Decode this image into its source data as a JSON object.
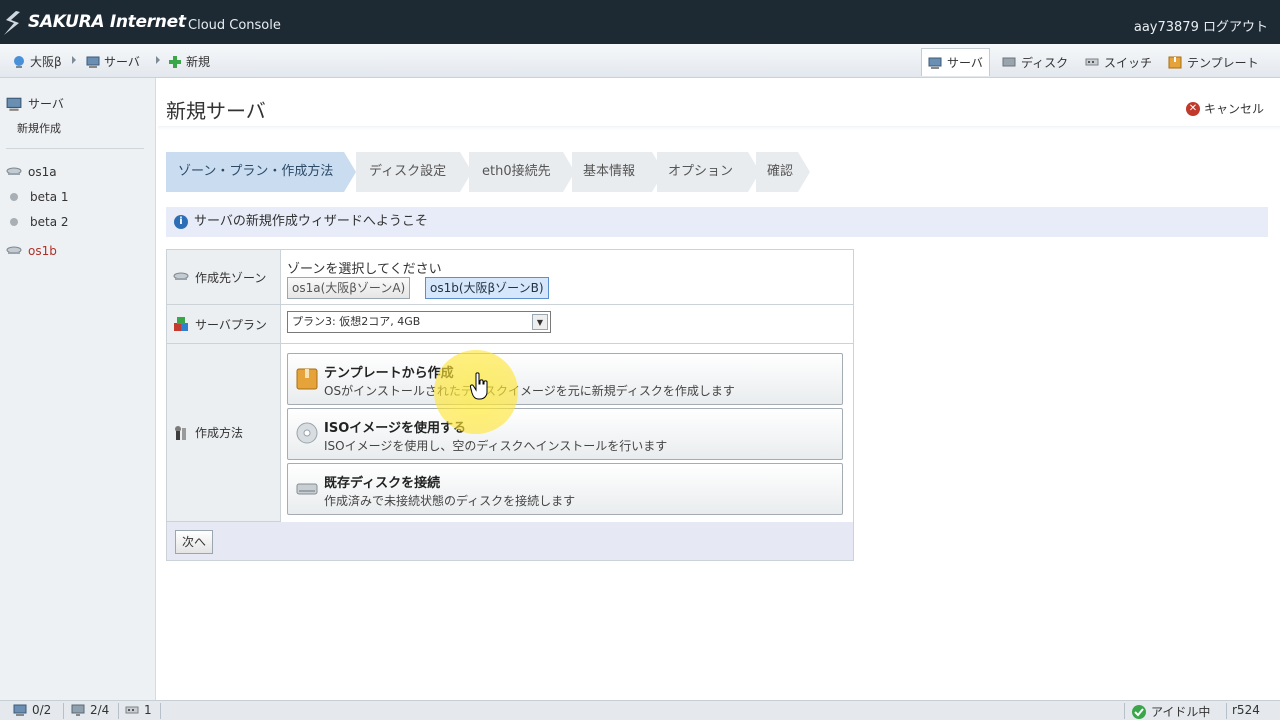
{
  "header": {
    "brand": "SAKURA Internet",
    "brand_sub": "Cloud Console",
    "user_id": "aay73879",
    "logout": "ログアウト"
  },
  "breadcrumb": {
    "zone": "大阪β",
    "server": "サーバ",
    "new": "新規"
  },
  "topnav": {
    "server": "サーバ",
    "disk": "ディスク",
    "switch": "スイッチ",
    "template": "テンプレート",
    "active": "server"
  },
  "sidebar": {
    "section": "サーバ",
    "section_sub": "新規作成",
    "items": [
      {
        "label": "os1a"
      },
      {
        "label": "beta 1"
      },
      {
        "label": "beta 2"
      },
      {
        "label": "os1b"
      }
    ]
  },
  "page": {
    "title": "新規サーバ",
    "cancel": "キャンセル"
  },
  "wizard": {
    "steps": [
      {
        "label": "ゾーン・プラン・作成方法",
        "active": true
      },
      {
        "label": "ディスク設定",
        "active": false
      },
      {
        "label": "eth0接続先",
        "active": false
      },
      {
        "label": "基本情報",
        "active": false
      },
      {
        "label": "オプション",
        "active": false
      },
      {
        "label": "確認",
        "active": false
      }
    ]
  },
  "info": {
    "text": "サーバの新規作成ウィザードへようこそ"
  },
  "form": {
    "zone_label": "作成先ゾーン",
    "zone_prompt": "ゾーンを選択してください",
    "zones": [
      {
        "label": "os1a(大阪βゾーンA)",
        "selected": false
      },
      {
        "label": "os1b(大阪βゾーンB)",
        "selected": true
      }
    ],
    "plan_label": "サーバプラン",
    "plan_value": "プラン3: 仮想2コア, 4GB",
    "method_label": "作成方法",
    "methods": [
      {
        "title": "テンプレートから作成",
        "desc": "OSがインストールされたディスクイメージを元に新規ディスクを作成します",
        "icon": "box-icon"
      },
      {
        "title": "ISOイメージを使用する",
        "desc": "ISOイメージを使用し、空のディスクへインストールを行います",
        "icon": "cd-icon"
      },
      {
        "title": "既存ディスクを接続",
        "desc": "作成済みで未接続状態のディスクを接続します",
        "icon": "disk-icon"
      }
    ],
    "next": "次へ"
  },
  "status": {
    "servers": "0/2",
    "vms": "2/4",
    "switches": "1",
    "state": "アイドル中",
    "rev": "r524"
  },
  "colors": {
    "header_bg": "#1e2a33",
    "active_step": "#c9dcf0",
    "info_bg": "#e7ecf8",
    "cancel_red": "#c0392b",
    "selected_zone": "#d7e7fb"
  }
}
